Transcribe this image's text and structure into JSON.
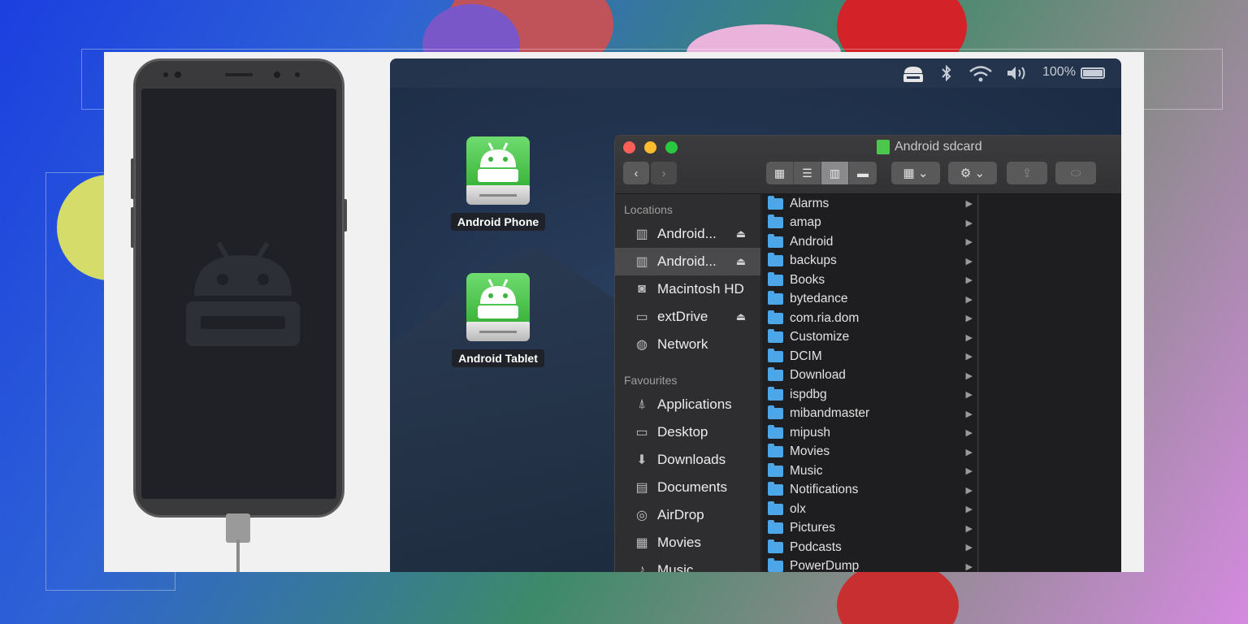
{
  "menubar": {
    "battery_text": "100%"
  },
  "desktop": {
    "icons": [
      {
        "label": "Android Phone"
      },
      {
        "label": "Android Tablet"
      }
    ]
  },
  "finder": {
    "title": "Android sdcard",
    "toolbar": {
      "back": "‹",
      "forward": "›",
      "view_icons": "▦",
      "view_list": "☰",
      "view_columns": "▥",
      "view_gallery": "▬",
      "group": "▦ ⌄",
      "action": "⚙ ⌄",
      "share": "⇪",
      "tag": "⬭"
    },
    "sidebar": {
      "locations_heading": "Locations",
      "locations": [
        {
          "label": "Android...",
          "eject": "⏏",
          "selected": false
        },
        {
          "label": "Android...",
          "eject": "⏏",
          "selected": true
        },
        {
          "label": "Macintosh HD",
          "eject": "",
          "selected": false
        },
        {
          "label": "extDrive",
          "eject": "⏏",
          "selected": false
        },
        {
          "label": "Network",
          "eject": "",
          "selected": false
        }
      ],
      "favourites_heading": "Favourites",
      "favourites": [
        {
          "label": "Applications"
        },
        {
          "label": "Desktop"
        },
        {
          "label": "Downloads"
        },
        {
          "label": "Documents"
        },
        {
          "label": "AirDrop"
        },
        {
          "label": "Movies"
        },
        {
          "label": "Music"
        }
      ]
    },
    "folders": [
      "Alarms",
      "amap",
      "Android",
      "backups",
      "Books",
      "bytedance",
      "com.ria.dom",
      "Customize",
      "DCIM",
      "Download",
      "ispdbg",
      "mibandmaster",
      "mipush",
      "Movies",
      "Music",
      "Notifications",
      "olx",
      "Pictures",
      "Podcasts",
      "PowerDump"
    ],
    "chevron": "▶"
  }
}
